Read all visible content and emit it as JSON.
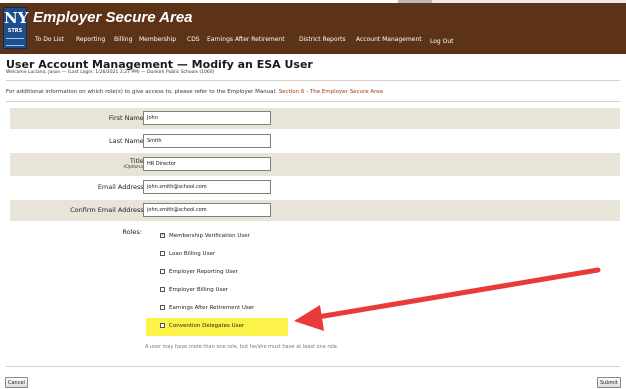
{
  "header": {
    "app_title": "Employer Secure Area",
    "logo_text": "NY",
    "logo_sub": "STRS",
    "nav": [
      {
        "label": "To Do List"
      },
      {
        "label": "Reporting"
      },
      {
        "label": "Billing"
      },
      {
        "label": "Membership"
      },
      {
        "label": "CDS"
      },
      {
        "label": "Earnings After Retirement"
      },
      {
        "label": "District Reports"
      },
      {
        "label": "Account Management"
      },
      {
        "label": "Log Out"
      }
    ]
  },
  "page": {
    "title": "User Account Management — Modify an ESA User",
    "welcome": "Welcome Luciano, Jason — (Last Login: 1/26/2021 3:27 PM) — Dunkirk Public Schools (1060)",
    "info_prefix": "For additional information on which role(s) to give access to, please refer to the Employer Manual: ",
    "info_link": "Section 6 - The Employer Secure Area"
  },
  "form": {
    "first_name": {
      "label": "First Name:",
      "value": "John"
    },
    "last_name": {
      "label": "Last Name:",
      "value": "Smith"
    },
    "title": {
      "label": "Title:",
      "optional": "(Optional)",
      "value": "HR Director"
    },
    "email": {
      "label": "Email Address:",
      "value": "john.smith@school.com"
    },
    "confirm_email": {
      "label": "Confirm Email Address:",
      "value": "john.smith@school.com"
    }
  },
  "roles": {
    "label": "Roles:",
    "items": [
      {
        "label": "Membership Verification User",
        "checked": true
      },
      {
        "label": "Loan Billing User",
        "checked": false
      },
      {
        "label": "Employer Reporting User",
        "checked": false
      },
      {
        "label": "Employer Billing User",
        "checked": false
      },
      {
        "label": "Earnings After Retirement User",
        "checked": false
      },
      {
        "label": "Convention Delegates User",
        "checked": false
      }
    ],
    "footnote": "A user may have more than one role, but he/she must have at least one role."
  },
  "actions": {
    "cancel_label": "Cancel",
    "submit_label": "Submit"
  },
  "colors": {
    "banner": "#5c3317",
    "shade": "#e8e4d8",
    "link": "#9b3b00",
    "highlight": "#fbf34a",
    "arrow": "#e83a3a"
  }
}
